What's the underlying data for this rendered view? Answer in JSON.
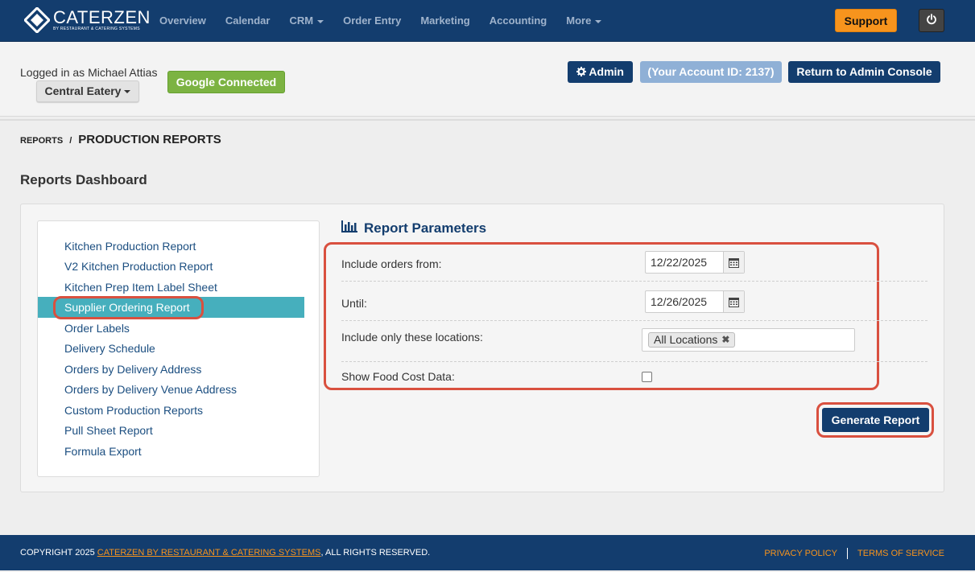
{
  "brand": {
    "name": "CATERZEN",
    "sub": "by RESTAURANT & CATERING SYSTEMS"
  },
  "nav": {
    "items": [
      "Overview",
      "Calendar",
      "CRM",
      "Order Entry",
      "Marketing",
      "Accounting",
      "More"
    ],
    "support_label": "Support"
  },
  "account": {
    "logged_in": "Logged in as Michael Attias",
    "location_button": "Central Eatery",
    "google_status": "Google Connected",
    "admin_label": "Admin",
    "account_id": "(Your Account ID: 2137)",
    "return_label": "Return to Admin Console"
  },
  "breadcrumb": {
    "parent": "REPORTS",
    "separator": "/",
    "current": "PRODUCTION REPORTS"
  },
  "page_title": "Reports Dashboard",
  "reports": {
    "items": [
      "Kitchen Production Report",
      "V2 Kitchen Production Report",
      "Kitchen Prep Item Label Sheet",
      "Supplier Ordering Report",
      "Order Labels",
      "Delivery Schedule",
      "Orders by Delivery Address",
      "Orders by Delivery Venue Address",
      "Custom Production Reports",
      "Pull Sheet Report",
      "Formula Export"
    ],
    "active": "Supplier Ordering Report"
  },
  "parameters": {
    "title": "Report Parameters",
    "from_label": "Include orders from:",
    "from_value": "12/22/2025",
    "until_label": "Until:",
    "until_value": "12/26/2025",
    "locations_label": "Include only these locations:",
    "locations_tag": "All Locations",
    "food_cost_label": "Show Food Cost Data:",
    "food_cost_checked": false,
    "generate_label": "Generate Report"
  },
  "footer": {
    "copyright_prefix": "COPYRIGHT 2025",
    "company_link": "CATERZEN BY RESTAURANT & CATERING SYSTEMS",
    "copyright_suffix": ", ALL RIGHTS RESERVED.",
    "privacy": "PRIVACY POLICY",
    "terms": "TERMS OF SERVICE"
  },
  "colors": {
    "nav_bg": "#133d6e",
    "accent_orange": "#f7941d",
    "active_item": "#46afbd",
    "highlight": "#d9503f",
    "google_green": "#7cb342"
  }
}
